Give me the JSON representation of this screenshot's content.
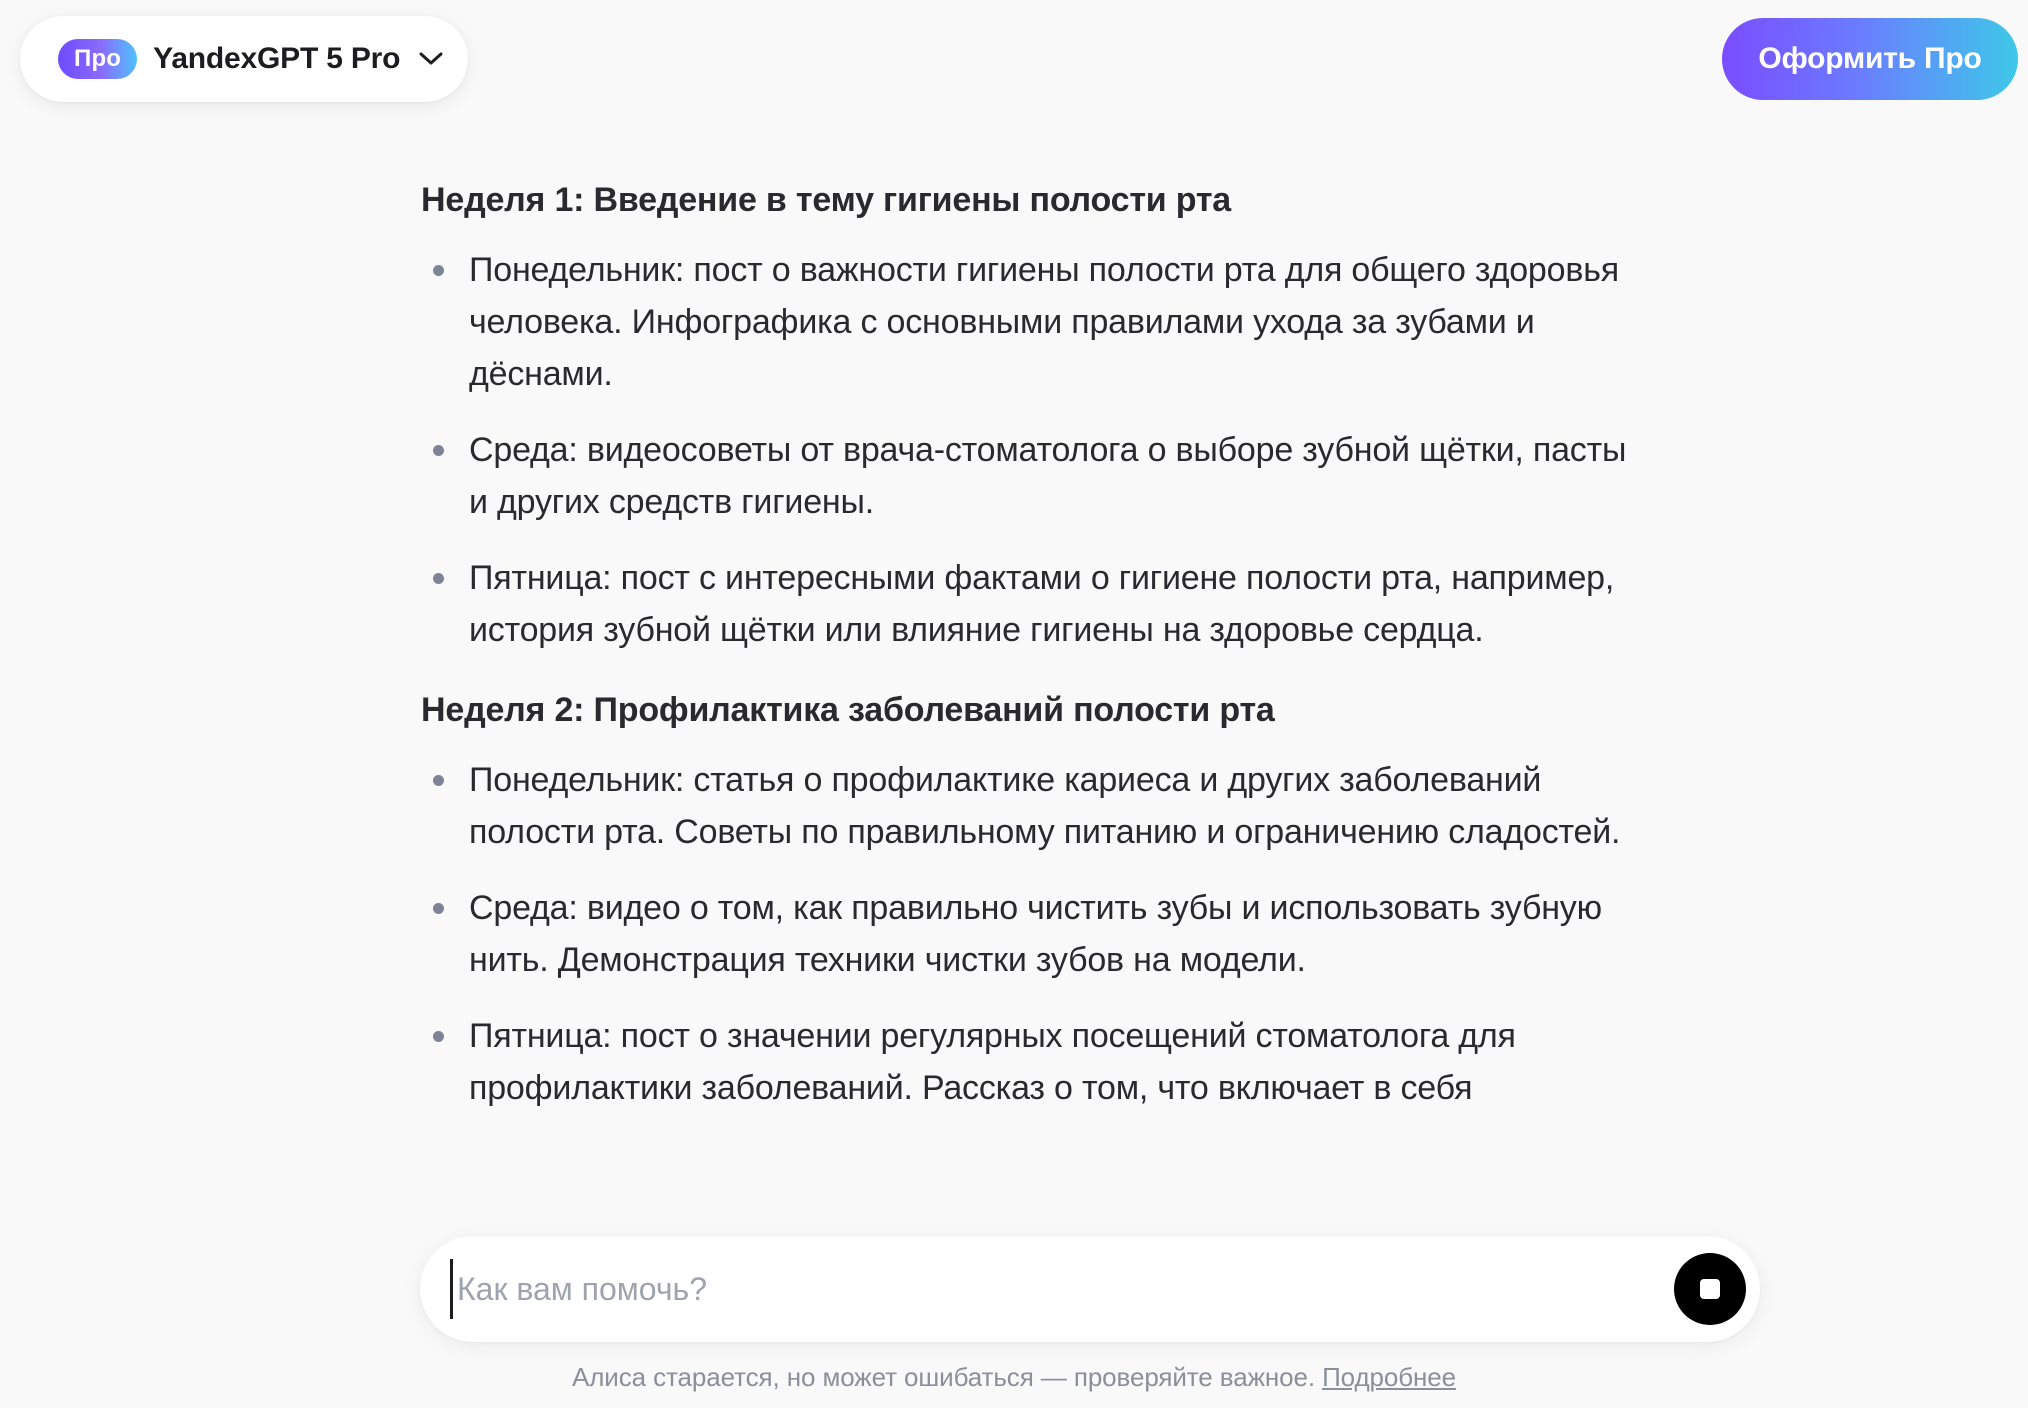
{
  "header": {
    "pro_badge": "Про",
    "model_name": "YandexGPT 5 Pro",
    "subscribe_label": "Оформить Про"
  },
  "content": {
    "weeks": [
      {
        "heading": "Неделя 1: Введение в тему гигиены полости рта",
        "items": [
          "Понедельник: пост о важности гигиены полости рта для общего здоровья человека. Инфографика с основными правилами ухода за зубами и дёснами.",
          "Среда: видеосоветы от врача-стоматолога о выборе зубной щётки, пасты и других средств гигиены.",
          "Пятница: пост с интересными фактами о гигиене полости рта, например, история зубной щётки или влияние гигиены на здоровье сердца."
        ]
      },
      {
        "heading": "Неделя 2: Профилактика заболеваний полости рта",
        "items": [
          "Понедельник: статья о профилактике кариеса и других заболеваний полости рта. Советы по правильному питанию и ограничению сладостей.",
          "Среда: видео о том, как правильно чистить зубы и использовать зубную нить. Демонстрация техники чистки зубов на модели.",
          "Пятница: пост о значении регулярных посещений стоматолога для профилактики заболеваний. Рассказ о том, что включает в себя"
        ]
      }
    ]
  },
  "input": {
    "placeholder": "Как вам помочь?"
  },
  "footer": {
    "disclaimer": "Алиса старается, но может ошибаться — проверяйте важное.",
    "more_link": "Подробнее"
  },
  "colors": {
    "background": "#f9f9fa",
    "pro_gradient_start": "#6d4bff",
    "pro_gradient_end": "#3ec8e8",
    "text": "#2a2a2e",
    "muted": "#8a8f99"
  }
}
